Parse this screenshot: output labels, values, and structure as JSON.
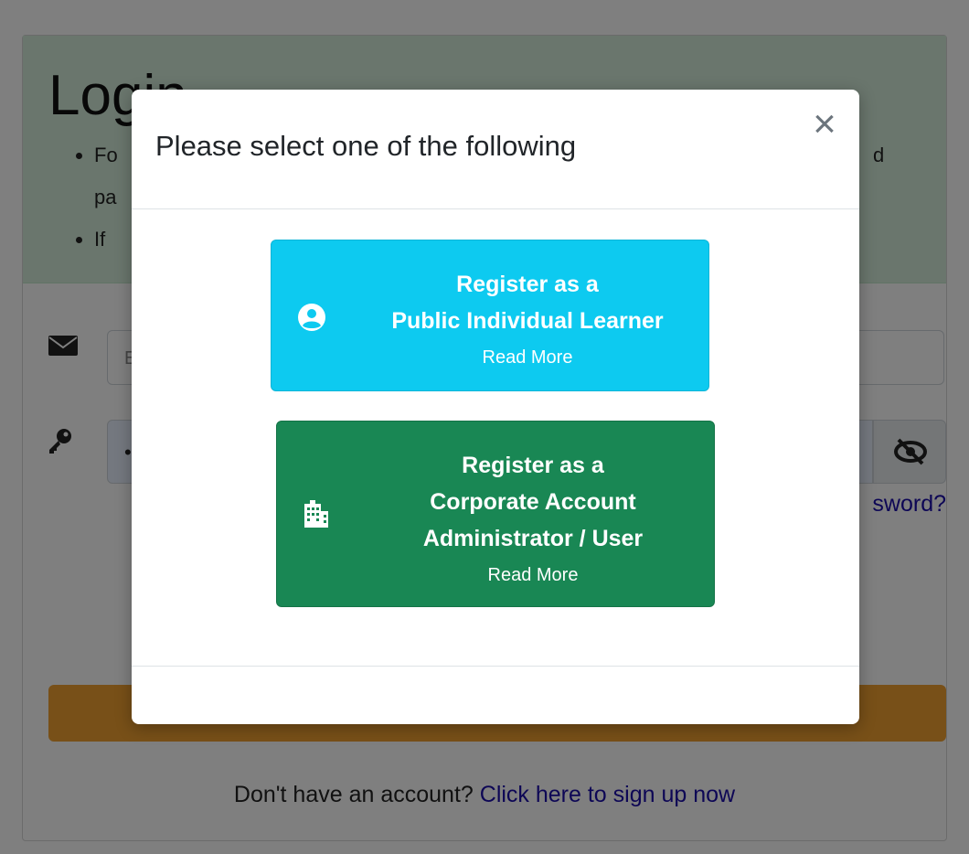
{
  "login_page": {
    "title": "Login",
    "info_items": [
      "Fo",
      "If"
    ],
    "info_continuation": "pa",
    "info_right_fragment": "d",
    "email_placeholder": "E",
    "password_value": "•",
    "forgot_password_fragment": "sword?",
    "login_button_fragment": "",
    "signup_prompt": "Don't have an account?",
    "signup_link": "Click here to sign up now"
  },
  "modal": {
    "title": "Please select one of the following",
    "close_icon": "close-icon",
    "options": [
      {
        "lines": [
          "Register as a",
          "Public Individual Learner"
        ],
        "read_more": "Read More",
        "icon": "user-circle-icon",
        "color": "#0dcaf0"
      },
      {
        "lines": [
          "Register as a",
          "Corporate Account",
          "Administrator / User"
        ],
        "read_more": "Read More",
        "icon": "building-icon",
        "color": "#198754"
      }
    ]
  },
  "colors": {
    "info_panel": "#d4edda",
    "login_button": "#f0a030",
    "link": "#1a0dab"
  }
}
